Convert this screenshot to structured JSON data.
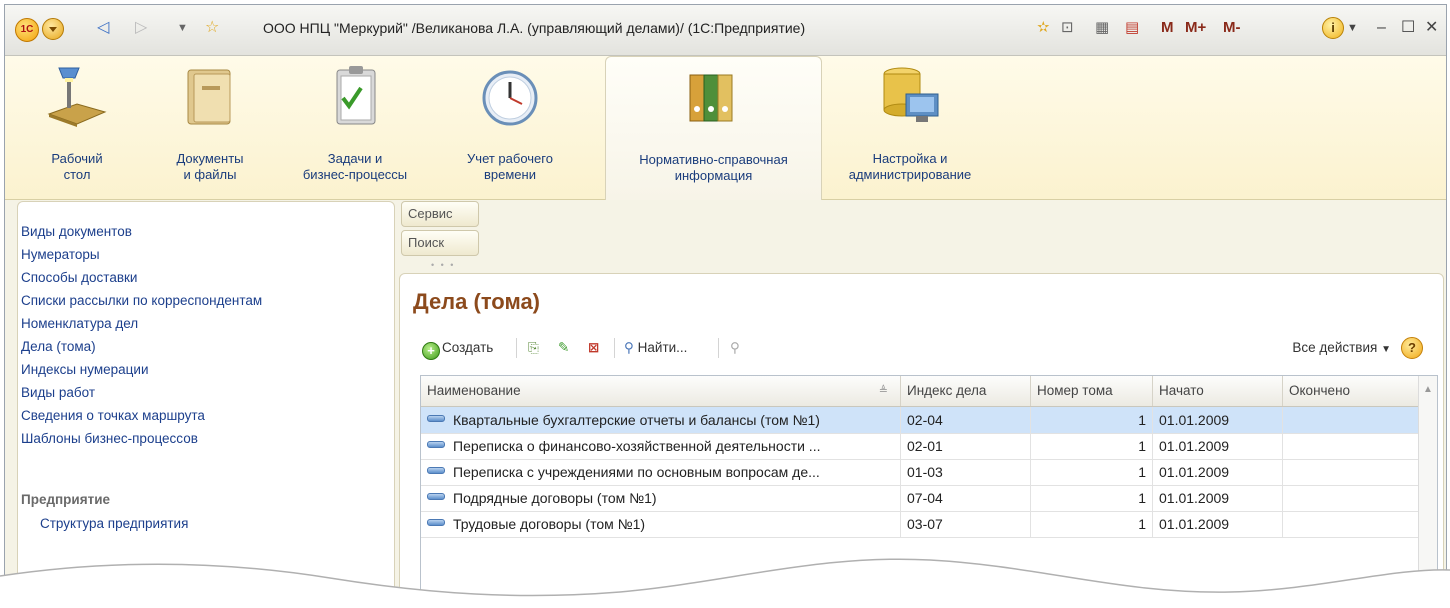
{
  "window": {
    "title": "ООО НПЦ \"Меркурий\" /Великанова Л.А. (управляющий делами)/  (1С:Предприятие)",
    "logo_text": "1С",
    "mbtns": [
      "M",
      "M+",
      "M-"
    ]
  },
  "sections": [
    {
      "label": "Рабочий\nстол",
      "icon": "desk-lamp-icon"
    },
    {
      "label": "Документы\nи файлы",
      "icon": "folder-icon"
    },
    {
      "label": "Задачи и\nбизнес-процессы",
      "icon": "clipboard-check-icon"
    },
    {
      "label": "Учет рабочего\nвремени",
      "icon": "clock-icon"
    },
    {
      "label": "Нормативно-справочная\nинформация",
      "icon": "binders-icon",
      "active": true
    },
    {
      "label": "Настройка и\nадминистрирование",
      "icon": "database-monitor-icon"
    }
  ],
  "leftnav": {
    "items": [
      "Виды документов",
      "Нумераторы",
      "Способы доставки",
      "Списки рассылки по корреспондентам",
      "Номенклатура дел",
      "Дела (тома)",
      "Индексы нумерации",
      "Виды работ",
      "Сведения о точках маршрута",
      "Шаблоны бизнес-процессов"
    ],
    "group": "Предприятие",
    "group_items": [
      "Структура предприятия"
    ]
  },
  "commands": {
    "service": "Сервис",
    "search": "Поиск"
  },
  "form": {
    "title": "Дела (тома)",
    "toolbar": {
      "create": "Создать",
      "find": "Найти...",
      "all_actions": "Все действия",
      "help": "?"
    },
    "columns": [
      "Наименование",
      "Индекс дела",
      "Номер тома",
      "Начато",
      "Окончено"
    ],
    "rows": [
      {
        "name": "Квартальные бухгалтерские отчеты и балансы (том №1)",
        "index": "02-04",
        "volume": "1",
        "start": "01.01.2009",
        "end": "",
        "selected": true
      },
      {
        "name": "Переписка о финансово-хозяйственной деятельности ...",
        "index": "02-01",
        "volume": "1",
        "start": "01.01.2009",
        "end": ""
      },
      {
        "name": "Переписка с учреждениями по основным вопросам де...",
        "index": "01-03",
        "volume": "1",
        "start": "01.01.2009",
        "end": ""
      },
      {
        "name": "Подрядные договоры (том №1)",
        "index": "07-04",
        "volume": "1",
        "start": "01.01.2009",
        "end": ""
      },
      {
        "name": "Трудовые договоры (том №1)",
        "index": "03-07",
        "volume": "1",
        "start": "01.01.2009",
        "end": ""
      }
    ]
  },
  "colors": {
    "link": "#1c3f8c",
    "form_title": "#8c4a1c",
    "selection": "#cfe3f9"
  }
}
